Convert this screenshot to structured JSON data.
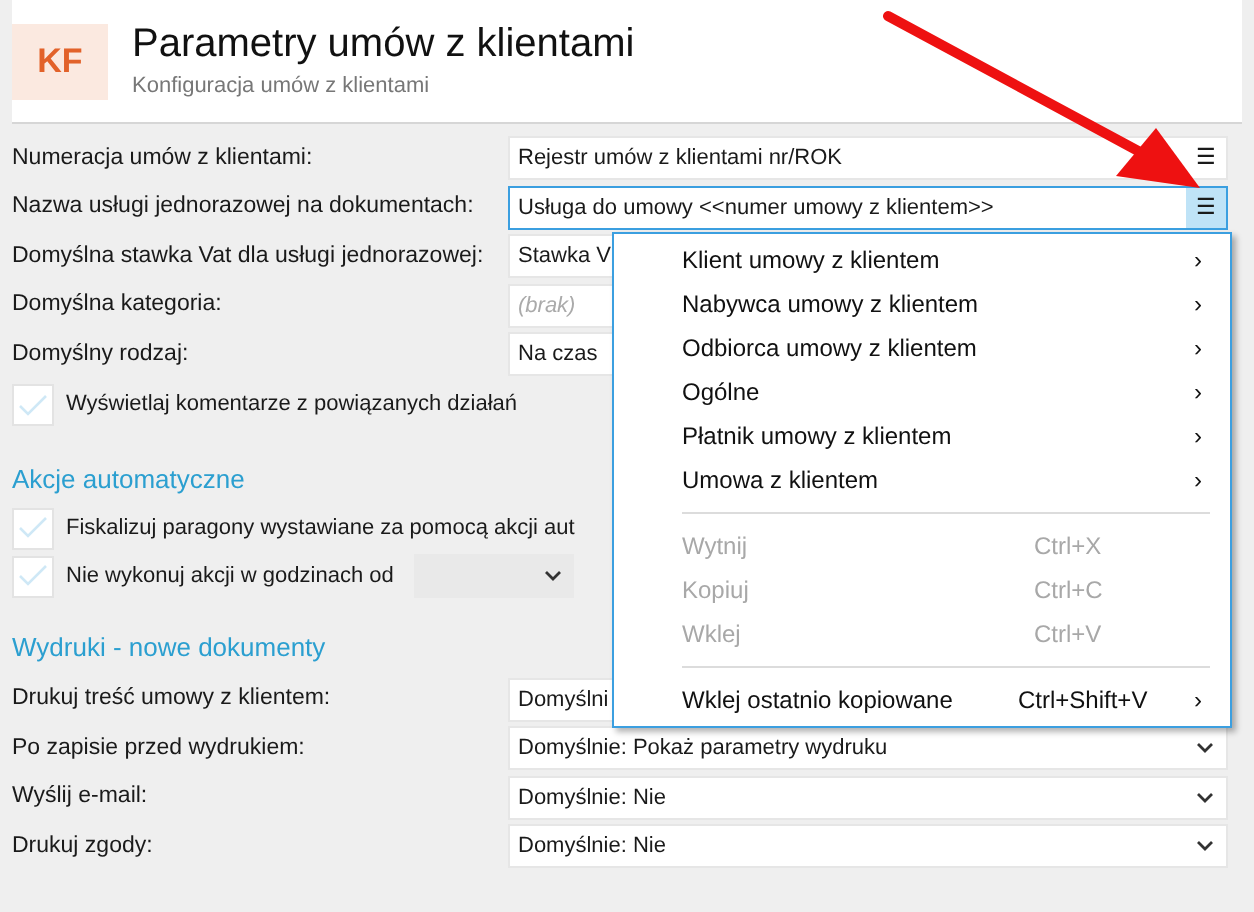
{
  "header": {
    "badge": "KF",
    "title": "Parametry umów z klientami",
    "subtitle": "Konfiguracja umów z klientami"
  },
  "fields": [
    {
      "label": "Numeracja umów z klientami:",
      "value": "Rejestr umów z klientami nr/ROK",
      "kind": "menu",
      "focused": false
    },
    {
      "label": "Nazwa usługi jednorazowej na dokumentach:",
      "value": "Usługa do umowy <<numer umowy z klientem>>",
      "kind": "menu",
      "focused": true
    },
    {
      "label": "Domyślna stawka Vat dla usługi jednorazowej:",
      "value": "Stawka V",
      "kind": "plain",
      "focused": false
    },
    {
      "label": "Domyślna kategoria:",
      "placeholder": "(brak)",
      "kind": "plain",
      "focused": false
    },
    {
      "label": "Domyślny rodzaj:",
      "value": "Na czas",
      "kind": "plain",
      "focused": false
    }
  ],
  "comments_checkbox": {
    "label": "Wyświetlaj komentarze z powiązanych działań",
    "checked": false
  },
  "auto_section": {
    "title": "Akcje automatyczne",
    "checkboxes": [
      {
        "label": "Fiskalizuj paragony wystawiane za pomocą akcji aut",
        "checked": false,
        "kind": "plain"
      },
      {
        "label": "Nie wykonuj akcji w godzinach od",
        "checked": false,
        "kind": "time"
      }
    ]
  },
  "print_section": {
    "title": "Wydruki - nowe dokumenty",
    "fields": [
      {
        "label": "Drukuj treść umowy z klientem:",
        "value": "Domyślni",
        "kind": "plain"
      },
      {
        "label": "Po zapisie przed wydrukiem:",
        "value": "Domyślnie: Pokaż parametry wydruku",
        "kind": "dropdown"
      },
      {
        "label": "Wyślij e-mail:",
        "value": "Domyślnie: Nie",
        "kind": "dropdown"
      },
      {
        "label": "Drukuj zgody:",
        "value": "Domyślnie: Nie",
        "kind": "dropdown"
      }
    ]
  },
  "context_menu": [
    {
      "kind": "submenu",
      "label": "Klient umowy z klientem",
      "arrow": "›",
      "disabled": false
    },
    {
      "kind": "submenu",
      "label": "Nabywca umowy z klientem",
      "arrow": "›",
      "disabled": false
    },
    {
      "kind": "submenu",
      "label": "Odbiorca umowy z klientem",
      "arrow": "›",
      "disabled": false
    },
    {
      "kind": "submenu",
      "label": "Ogólne",
      "arrow": "›",
      "disabled": false
    },
    {
      "kind": "submenu",
      "label": "Płatnik umowy z klientem",
      "arrow": "›",
      "disabled": false
    },
    {
      "kind": "submenu",
      "label": "Umowa z klientem",
      "arrow": "›",
      "disabled": false
    },
    {
      "kind": "separator"
    },
    {
      "kind": "command",
      "label": "Wytnij",
      "shortcut": "Ctrl+X",
      "disabled": true
    },
    {
      "kind": "command",
      "label": "Kopiuj",
      "shortcut": "Ctrl+C",
      "disabled": true
    },
    {
      "kind": "command",
      "label": "Wklej",
      "shortcut": "Ctrl+V",
      "disabled": true
    },
    {
      "kind": "separator"
    },
    {
      "kind": "command",
      "label": "Wklej ostatnio kopiowane",
      "shortcut": "Ctrl+Shift+V",
      "arrow": "›",
      "disabled": false
    }
  ],
  "menu_button": {
    "glyph": "☰"
  }
}
